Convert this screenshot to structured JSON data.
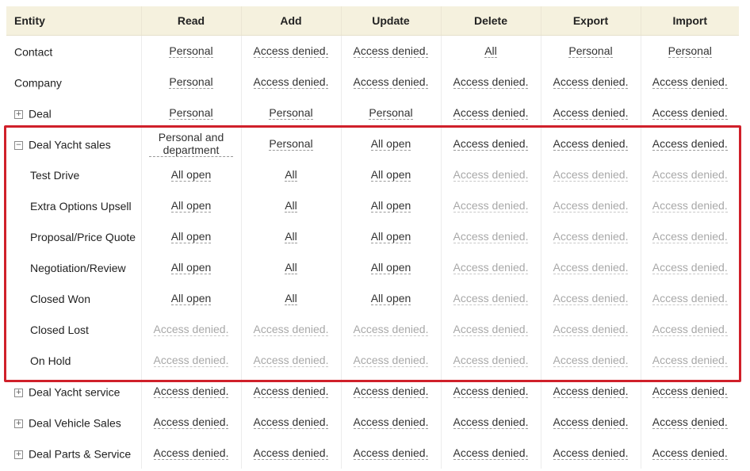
{
  "headers": [
    "Entity",
    "Read",
    "Add",
    "Update",
    "Delete",
    "Export",
    "Import"
  ],
  "rows": [
    {
      "toggle": "",
      "indent": false,
      "entity": "Contact",
      "cells": [
        [
          "Personal",
          "d"
        ],
        [
          "Access denied.",
          "d"
        ],
        [
          "Access denied.",
          "d"
        ],
        [
          "All",
          "d"
        ],
        [
          "Personal",
          "d"
        ],
        [
          "Personal",
          "d"
        ]
      ]
    },
    {
      "toggle": "",
      "indent": false,
      "entity": "Company",
      "cells": [
        [
          "Personal",
          "d"
        ],
        [
          "Access denied.",
          "d"
        ],
        [
          "Access denied.",
          "d"
        ],
        [
          "Access denied.",
          "d"
        ],
        [
          "Access denied.",
          "d"
        ],
        [
          "Access denied.",
          "d"
        ]
      ]
    },
    {
      "toggle": "+",
      "indent": false,
      "entity": "Deal",
      "cells": [
        [
          "Personal",
          "d"
        ],
        [
          "Personal",
          "d"
        ],
        [
          "Personal",
          "d"
        ],
        [
          "Access denied.",
          "d"
        ],
        [
          "Access denied.",
          "d"
        ],
        [
          "Access denied.",
          "d"
        ]
      ]
    },
    {
      "toggle": "−",
      "indent": false,
      "entity": "Deal Yacht sales",
      "cells": [
        [
          "Personal and department",
          "d"
        ],
        [
          "Personal",
          "d"
        ],
        [
          "All open",
          "d"
        ],
        [
          "Access denied.",
          "d"
        ],
        [
          "Access denied.",
          "d"
        ],
        [
          "Access denied.",
          "d"
        ]
      ]
    },
    {
      "toggle": "",
      "indent": true,
      "entity": "Test Drive",
      "cells": [
        [
          "All open",
          "d"
        ],
        [
          "All",
          "d"
        ],
        [
          "All open",
          "d"
        ],
        [
          "Access denied.",
          "m"
        ],
        [
          "Access denied.",
          "m"
        ],
        [
          "Access denied.",
          "m"
        ]
      ]
    },
    {
      "toggle": "",
      "indent": true,
      "entity": "Extra Options Upsell",
      "cells": [
        [
          "All open",
          "d"
        ],
        [
          "All",
          "d"
        ],
        [
          "All open",
          "d"
        ],
        [
          "Access denied.",
          "m"
        ],
        [
          "Access denied.",
          "m"
        ],
        [
          "Access denied.",
          "m"
        ]
      ]
    },
    {
      "toggle": "",
      "indent": true,
      "entity": "Proposal/Price Quote",
      "cells": [
        [
          "All open",
          "d"
        ],
        [
          "All",
          "d"
        ],
        [
          "All open",
          "d"
        ],
        [
          "Access denied.",
          "m"
        ],
        [
          "Access denied.",
          "m"
        ],
        [
          "Access denied.",
          "m"
        ]
      ]
    },
    {
      "toggle": "",
      "indent": true,
      "entity": "Negotiation/Review",
      "cells": [
        [
          "All open",
          "d"
        ],
        [
          "All",
          "d"
        ],
        [
          "All open",
          "d"
        ],
        [
          "Access denied.",
          "m"
        ],
        [
          "Access denied.",
          "m"
        ],
        [
          "Access denied.",
          "m"
        ]
      ]
    },
    {
      "toggle": "",
      "indent": true,
      "entity": "Closed Won",
      "cells": [
        [
          "All open",
          "d"
        ],
        [
          "All",
          "d"
        ],
        [
          "All open",
          "d"
        ],
        [
          "Access denied.",
          "m"
        ],
        [
          "Access denied.",
          "m"
        ],
        [
          "Access denied.",
          "m"
        ]
      ]
    },
    {
      "toggle": "",
      "indent": true,
      "entity": "Closed Lost",
      "cells": [
        [
          "Access denied.",
          "m"
        ],
        [
          "Access denied.",
          "m"
        ],
        [
          "Access denied.",
          "m"
        ],
        [
          "Access denied.",
          "m"
        ],
        [
          "Access denied.",
          "m"
        ],
        [
          "Access denied.",
          "m"
        ]
      ]
    },
    {
      "toggle": "",
      "indent": true,
      "entity": "On Hold",
      "cells": [
        [
          "Access denied.",
          "m"
        ],
        [
          "Access denied.",
          "m"
        ],
        [
          "Access denied.",
          "m"
        ],
        [
          "Access denied.",
          "m"
        ],
        [
          "Access denied.",
          "m"
        ],
        [
          "Access denied.",
          "m"
        ]
      ]
    },
    {
      "toggle": "+",
      "indent": false,
      "entity": "Deal Yacht service",
      "cells": [
        [
          "Access denied.",
          "d"
        ],
        [
          "Access denied.",
          "d"
        ],
        [
          "Access denied.",
          "d"
        ],
        [
          "Access denied.",
          "d"
        ],
        [
          "Access denied.",
          "d"
        ],
        [
          "Access denied.",
          "d"
        ]
      ]
    },
    {
      "toggle": "+",
      "indent": false,
      "entity": "Deal Vehicle Sales",
      "cells": [
        [
          "Access denied.",
          "d"
        ],
        [
          "Access denied.",
          "d"
        ],
        [
          "Access denied.",
          "d"
        ],
        [
          "Access denied.",
          "d"
        ],
        [
          "Access denied.",
          "d"
        ],
        [
          "Access denied.",
          "d"
        ]
      ]
    },
    {
      "toggle": "+",
      "indent": false,
      "entity": "Deal Parts & Service",
      "cells": [
        [
          "Access denied.",
          "d"
        ],
        [
          "Access denied.",
          "d"
        ],
        [
          "Access denied.",
          "d"
        ],
        [
          "Access denied.",
          "d"
        ],
        [
          "Access denied.",
          "d"
        ],
        [
          "Access denied.",
          "d"
        ]
      ]
    }
  ],
  "colors": {
    "header_bg": "#f5f1de",
    "highlight_border": "#d0202a",
    "muted_text": "#a8a8a8"
  }
}
